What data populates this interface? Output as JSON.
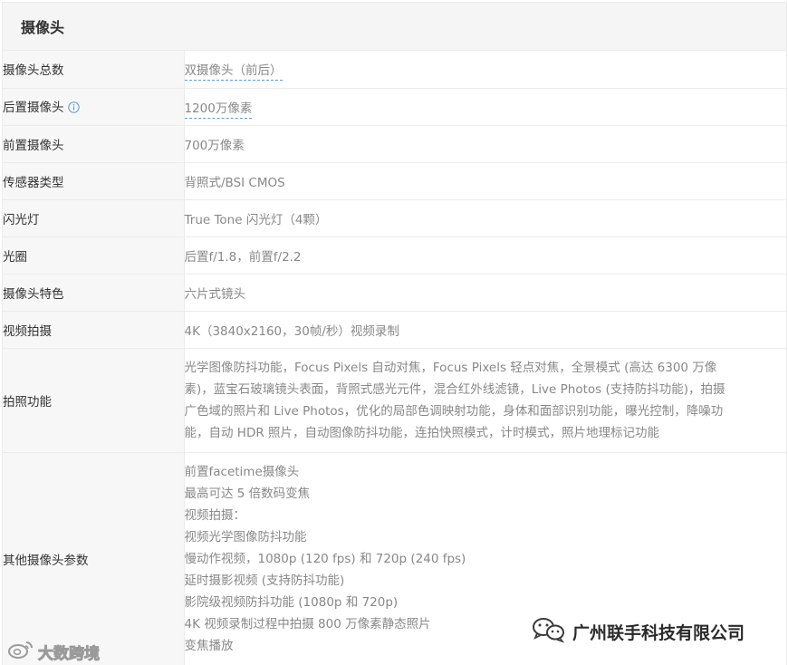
{
  "section": {
    "title": "摄像头"
  },
  "rows": [
    {
      "label": "摄像头总数",
      "value": "双摄像头（前后）"
    },
    {
      "label": "后置摄像头",
      "value": "1200万像素"
    },
    {
      "label": "前置摄像头",
      "value": "700万像素"
    },
    {
      "label": "传感器类型",
      "value": "背照式/BSI CMOS"
    },
    {
      "label": "闪光灯",
      "value": "True Tone 闪光灯（4颗）"
    },
    {
      "label": "光圈",
      "value": "后置f/1.8，前置f/2.2"
    },
    {
      "label": "摄像头特色",
      "value": "六片式镜头"
    },
    {
      "label": "视频拍摄",
      "value": "4K（3840x2160，30帧/秒）视频录制"
    },
    {
      "label": "拍照功能",
      "lines": [
        "光学图像防抖功能，Focus Pixels 自动对焦，Focus Pixels 轻点对焦，全景模式 (高达 6300 万像",
        "素)，蓝宝石玻璃镜头表面，背照式感光元件，混合红外线滤镜，Live Photos (支持防抖功能)，拍摄",
        "广色域的照片和 Live Photos，优化的局部色调映射功能，身体和面部识别功能，曝光控制，降噪功",
        "能，自动 HDR 照片，自动图像防抖功能，连拍快照模式，计时模式，照片地理标记功能"
      ]
    },
    {
      "label": "其他摄像头参数",
      "lines": [
        "前置facetime摄像头",
        "最高可达 5 倍数码变焦",
        "视频拍摄：",
        "视频光学图像防抖功能",
        "慢动作视频，1080p (120 fps) 和 720p (240 fps)",
        "延时摄影视频 (支持防抖功能)",
        "影院级视频防抖功能 (1080p 和 720p)",
        "4K 视频录制过程中拍摄 800 万像素静态照片",
        "变焦播放"
      ]
    }
  ],
  "watermarks": {
    "left": "大数跨境",
    "right": "广州联手科技有限公司"
  },
  "colors": {
    "link_underline": "#5a9bd8",
    "info_icon": "#5a9bd8",
    "label_bg": "#f7f7f7",
    "header_bg": "#f5f5f5"
  }
}
